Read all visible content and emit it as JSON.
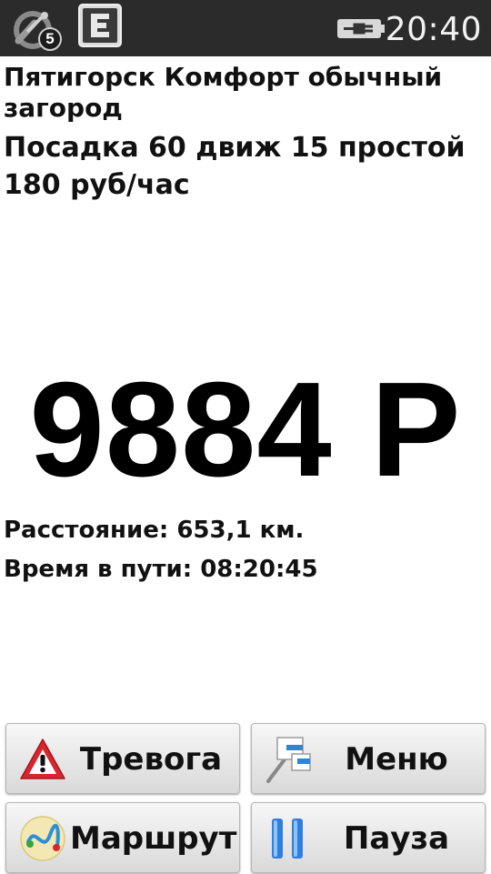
{
  "status_bar": {
    "satellites_count": "5",
    "time": "20:40",
    "icons": [
      "gps-satellite-icon",
      "e-app-icon",
      "battery-charging-icon"
    ]
  },
  "tariff": {
    "name": "Пятигорск Комфорт обычный загород",
    "rates": "Посадка 60 движ 15 простой 180 руб/час"
  },
  "fare": {
    "amount": "9884 Р"
  },
  "trip": {
    "distance": "Расстояние: 653,1 км.",
    "duration": "Время в пути: 08:20:45"
  },
  "buttons": {
    "alarm": {
      "label": "Тревога",
      "icon": "warning-triangle-icon"
    },
    "menu": {
      "label": "Меню",
      "icon": "menu-flags-icon"
    },
    "route": {
      "label": "Маршрут",
      "icon": "route-map-icon"
    },
    "pause": {
      "label": "Пауза",
      "icon": "pause-icon"
    }
  },
  "colors": {
    "status_bar_bg": "#2b2b2b",
    "alarm_red": "#d8262e",
    "pause_blue": "#2f7fe0"
  }
}
